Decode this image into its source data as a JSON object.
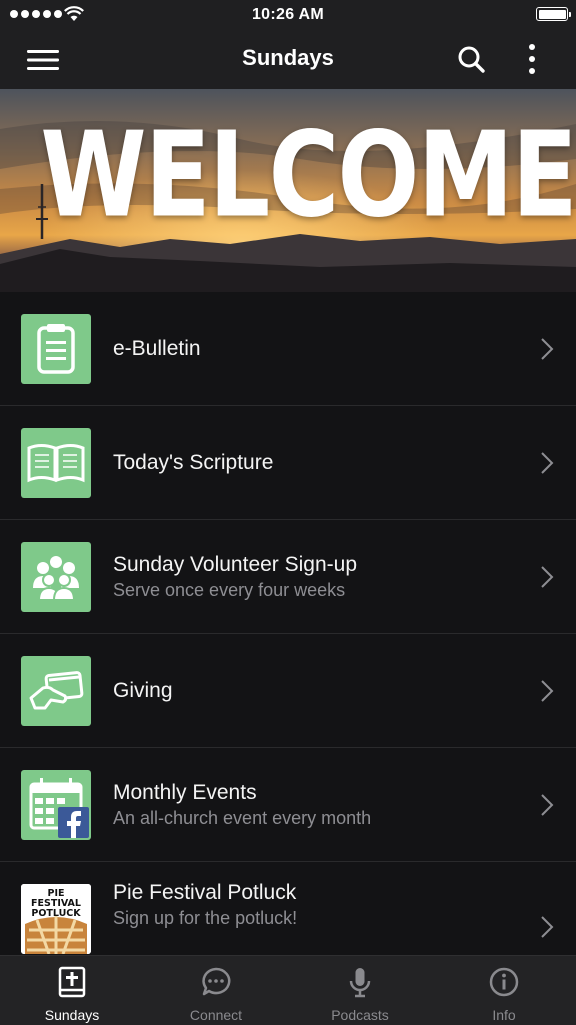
{
  "status_bar": {
    "time": "10:26 AM"
  },
  "nav": {
    "title": "Sundays"
  },
  "hero": {
    "text": "WELCOME"
  },
  "items": [
    {
      "title": "e-Bulletin",
      "subtitle": "",
      "icon": "clipboard-icon"
    },
    {
      "title": "Today's Scripture",
      "subtitle": "",
      "icon": "book-icon"
    },
    {
      "title": "Sunday Volunteer Sign-up",
      "subtitle": "Serve once every four weeks",
      "icon": "people-icon"
    },
    {
      "title": "Giving",
      "subtitle": "",
      "icon": "giving-card-icon"
    },
    {
      "title": "Monthly Events",
      "subtitle": "An all-church event every month",
      "icon": "calendar-facebook-icon"
    },
    {
      "title": "Pie Festival Potluck",
      "subtitle": "Sign up for the potluck!",
      "icon": "pie-festival-thumbnail",
      "thumb_text": "PIE FESTIVAL POTLUCK"
    }
  ],
  "tabs": [
    {
      "label": "Sundays",
      "icon": "bible-icon",
      "active": true
    },
    {
      "label": "Connect",
      "icon": "chat-bubble-icon",
      "active": false
    },
    {
      "label": "Podcasts",
      "icon": "microphone-icon",
      "active": false
    },
    {
      "label": "Info",
      "icon": "info-icon",
      "active": false
    }
  ],
  "colors": {
    "accent_green": "#7fc98a",
    "background": "#131315",
    "bar": "#1f1f21"
  }
}
